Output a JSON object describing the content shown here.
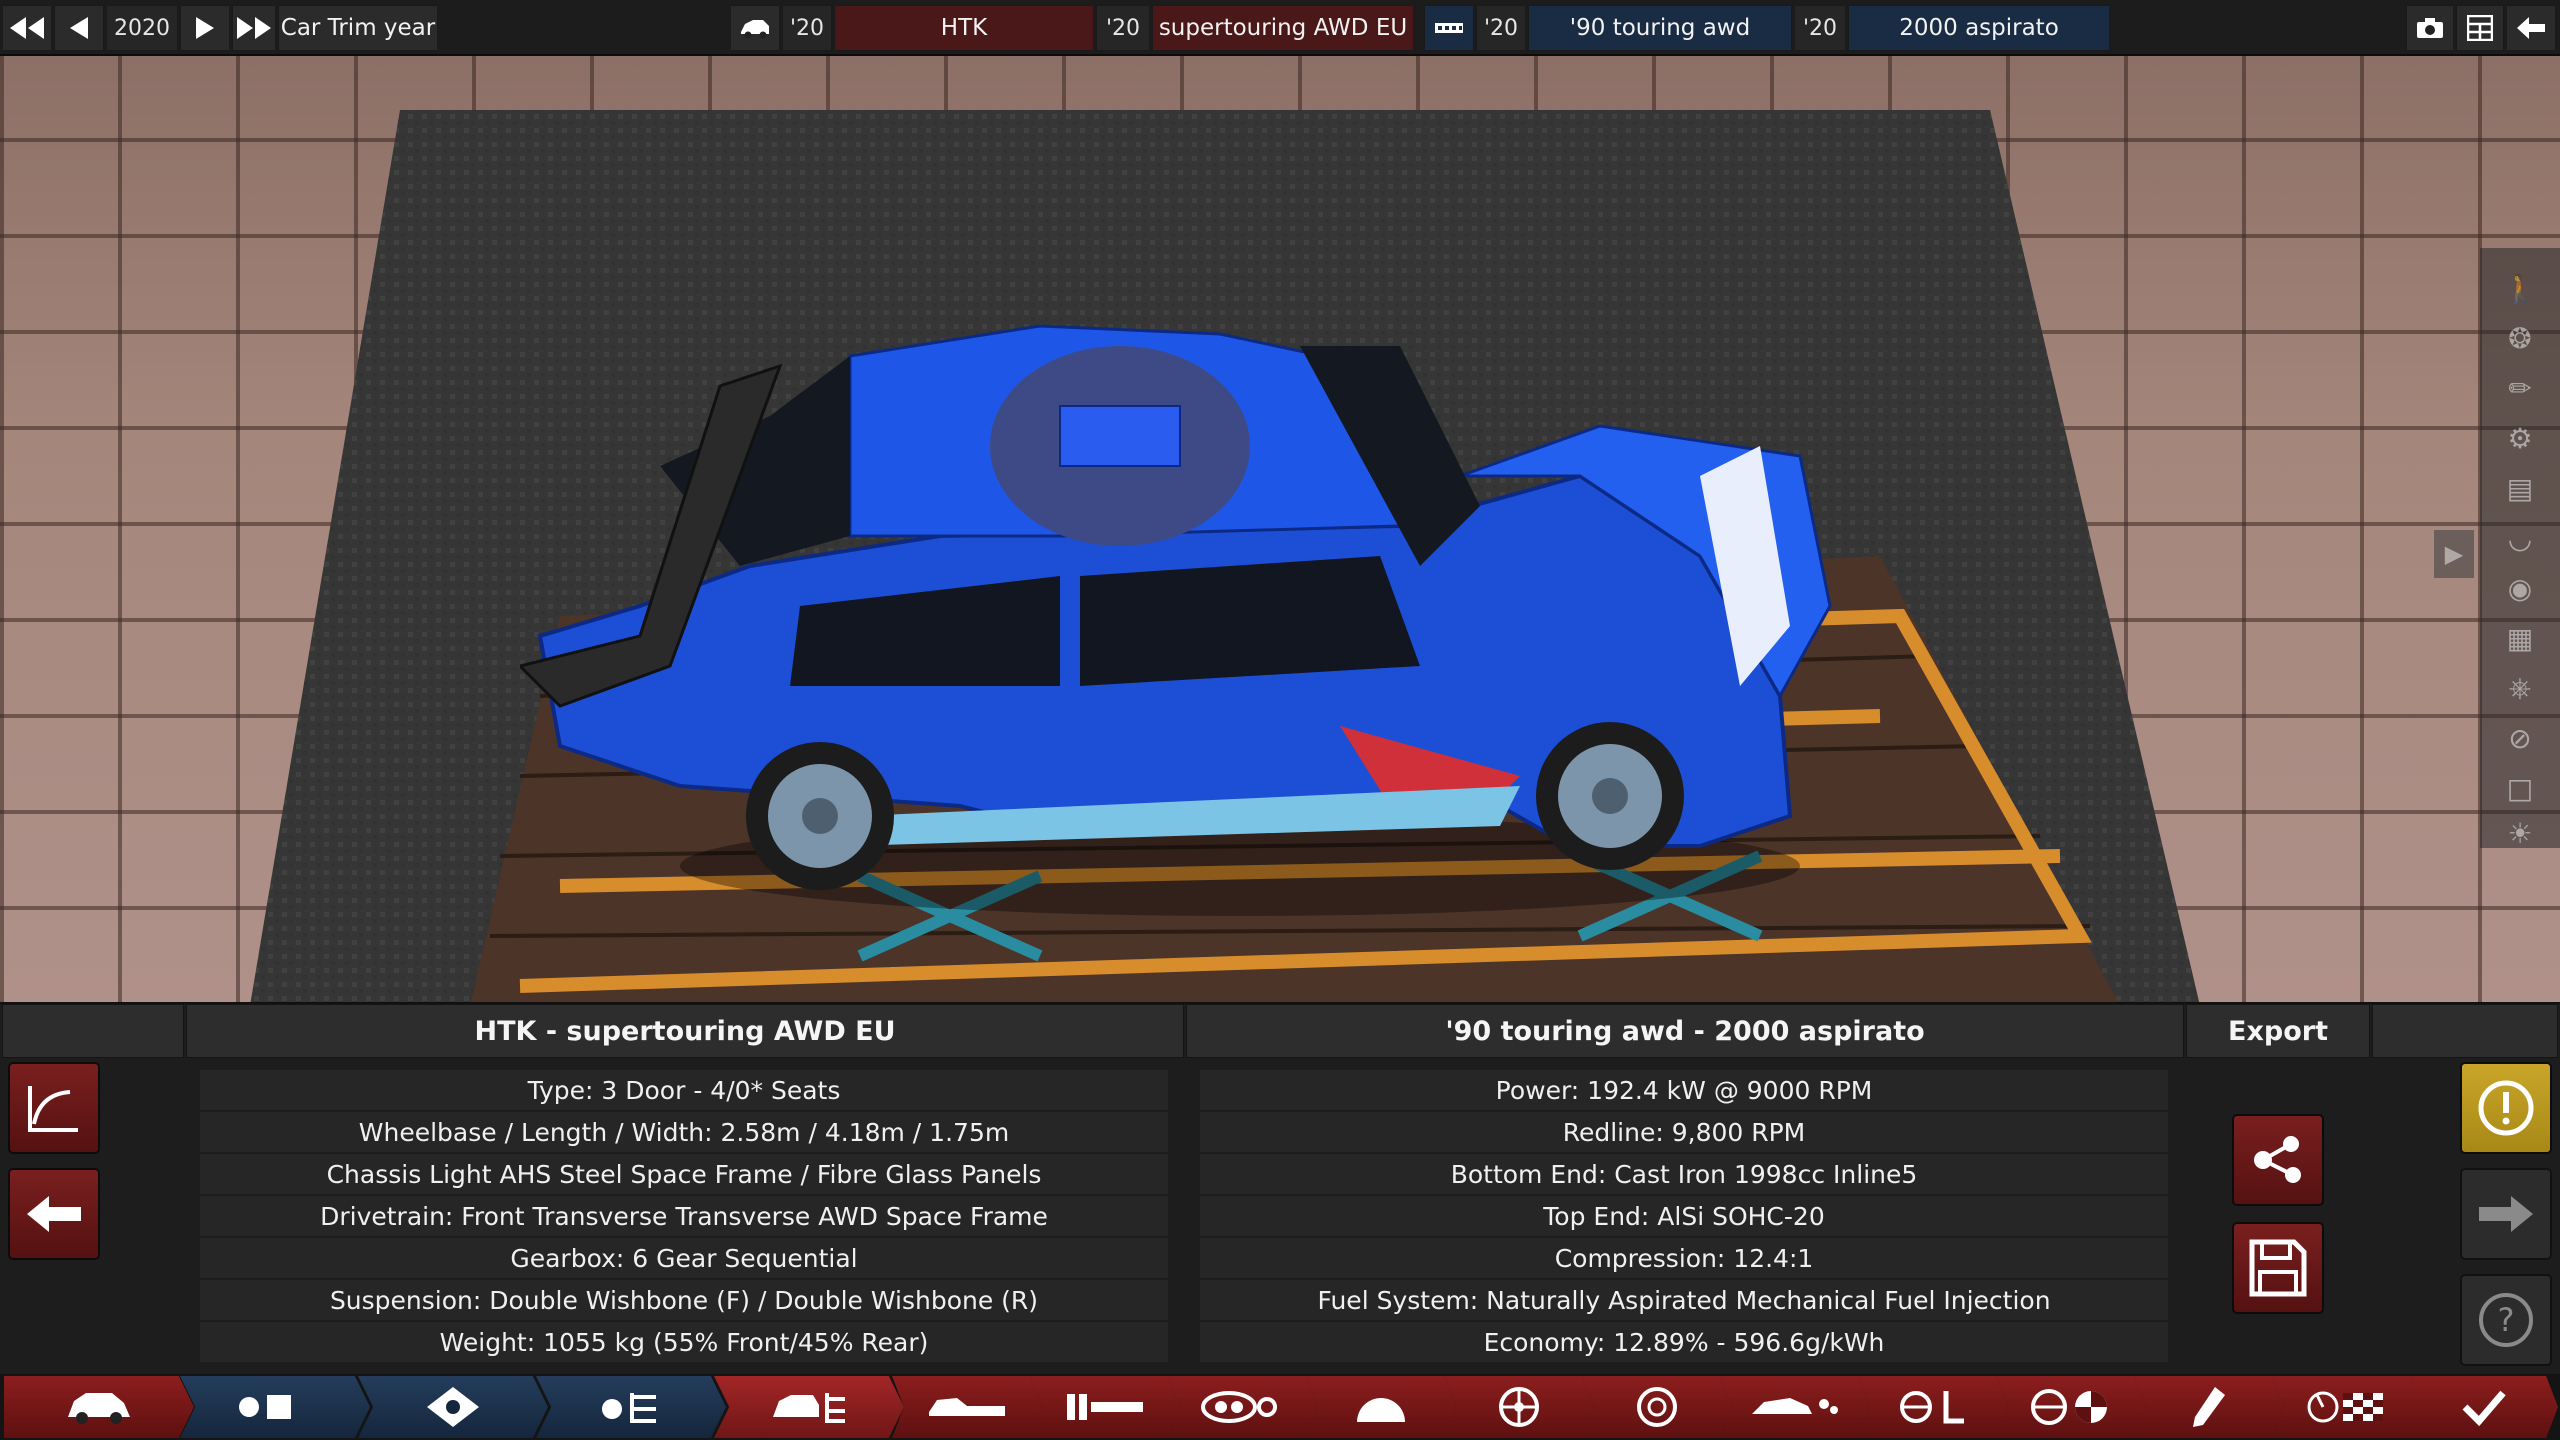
{
  "topbar": {
    "year_value": "2020",
    "year_label": "Car Trim year",
    "model_year": "'20",
    "model_name": "HTK",
    "trim_year": "'20",
    "trim_name": "supertouring AWD EU",
    "family_year": "'20",
    "family_name": "'90 touring awd",
    "variant_year": "'20",
    "variant_name": "2000 aspirato"
  },
  "panel": {
    "car_title": "HTK - supertouring AWD EU",
    "engine_title": "'90 touring awd - 2000 aspirato",
    "export_title": "Export",
    "car_specs": [
      "Type: 3 Door - 4/0* Seats",
      "Wheelbase / Length / Width: 2.58m / 4.18m / 1.75m",
      "Chassis Light AHS Steel Space Frame / Fibre Glass Panels",
      "Drivetrain: Front Transverse Transverse AWD Space Frame",
      "Gearbox: 6 Gear Sequential",
      "Suspension: Double Wishbone (F) / Double Wishbone (R)",
      "Weight: 1055 kg (55% Front/45% Rear)"
    ],
    "engine_specs": [
      "Power: 192.4 kW @ 9000 RPM",
      "Redline:  9,800 RPM",
      "Bottom End: Cast Iron 1998cc Inline5",
      "Top End: AlSi SOHC-20",
      "Compression: 12.4:1",
      "Fuel System: Naturally Aspirated Mechanical Fuel Injection",
      "Economy: 12.89% - 596.6g/kWh"
    ]
  },
  "colors": {
    "accent_red": "#8c1e1e",
    "accent_blue": "#243d5c",
    "warning_yellow": "#c9a629",
    "car_blue": "#1d4fd6"
  },
  "icons": {
    "topbar": [
      "rewind-icon",
      "prev-icon",
      "play-icon",
      "fast-forward-icon",
      "car-icon",
      "engine-icon",
      "camera-icon",
      "layout-icon",
      "back-icon"
    ],
    "right_toolbar": [
      "person-icon",
      "wheel-icon",
      "spray-icon",
      "engine-bay-icon",
      "panel-icon",
      "fender-icon",
      "light-icon",
      "grille-icon",
      "seat-icon",
      "no-icon",
      "square-icon",
      "bulb-icon"
    ],
    "bottom_toolbar": [
      "car-body-icon",
      "engine-family-icon",
      "engine-icon",
      "engine-tune-icon",
      "car-trim-icon",
      "chassis-icon",
      "suspension-icon",
      "drivetrain-icon",
      "gearbox-icon",
      "wheels-icon",
      "brakes-icon",
      "aero-icon",
      "interior-icon",
      "safety-icon",
      "tuning-icon",
      "testing-icon",
      "finish-icon"
    ]
  }
}
